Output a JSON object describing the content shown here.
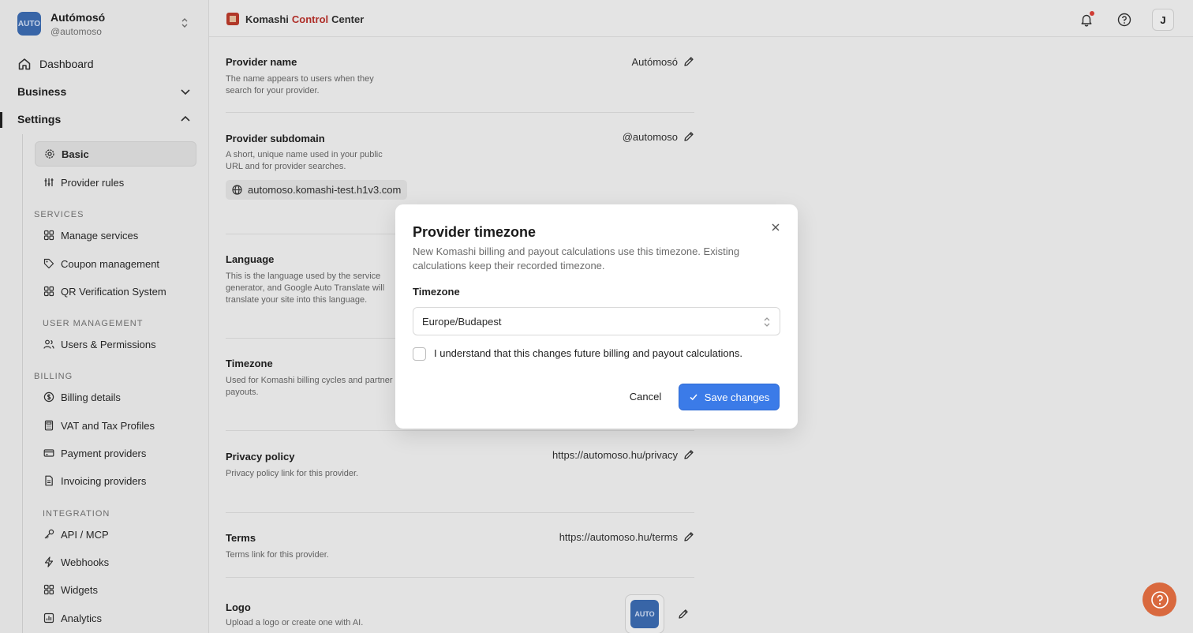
{
  "account": {
    "name": "Autómosó",
    "handle": "@automoso",
    "avatar_text": "AUTO"
  },
  "nav": {
    "dashboard": "Dashboard",
    "business": "Business",
    "settings": "Settings",
    "basic": "Basic",
    "provider_rules": "Provider rules",
    "services_header": "SERVICES",
    "manage_services": "Manage services",
    "coupon_management": "Coupon management",
    "qr_verification": "QR Verification System",
    "user_mgmt_header": "USER MANAGEMENT",
    "users_permissions": "Users & Permissions",
    "billing_header": "BILLING",
    "billing_details": "Billing details",
    "vat_tax": "VAT and Tax Profiles",
    "payment_providers": "Payment providers",
    "invoicing_providers": "Invoicing providers",
    "integration_header": "INTEGRATION",
    "api_mcp": "API / MCP",
    "webhooks": "Webhooks",
    "widgets": "Widgets",
    "analytics": "Analytics"
  },
  "header": {
    "brand_part1": "Komashi",
    "brand_part2": "Control",
    "brand_part3": "Center",
    "user_initial": "J"
  },
  "settings": {
    "provider_name": {
      "title": "Provider name",
      "desc": "The name appears to users when they search for your provider.",
      "value": "Autómosó"
    },
    "provider_subdomain": {
      "title": "Provider subdomain",
      "desc": "A short, unique name used in your public URL and for provider searches.",
      "value": "@automoso",
      "url": "automoso.komashi-test.h1v3.com"
    },
    "language": {
      "title": "Language",
      "desc": "This is the language used by the service generator, and Google Auto Translate will translate your site into this language."
    },
    "timezone": {
      "title": "Timezone",
      "desc": "Used for Komashi billing cycles and partner payouts."
    },
    "privacy_policy": {
      "title": "Privacy policy",
      "desc": "Privacy policy link for this provider.",
      "value": "https://automoso.hu/privacy"
    },
    "terms": {
      "title": "Terms",
      "desc": "Terms link for this provider.",
      "value": "https://automoso.hu/terms"
    },
    "logo": {
      "title": "Logo",
      "desc": "Upload a logo or create one with AI.",
      "logo_text": "AUTO"
    }
  },
  "modal": {
    "title": "Provider timezone",
    "description": "New Komashi billing and payout calculations use this timezone. Existing calculations keep their recorded timezone.",
    "timezone_label": "Timezone",
    "timezone_value": "Europe/Budapest",
    "checkbox_label": "I understand that this changes future billing and payout calculations.",
    "cancel_label": "Cancel",
    "save_label": "Save changes"
  },
  "colors": {
    "accent": "#3b7be8",
    "brand_red": "#c0322b",
    "help_fab": "#d9693e"
  }
}
